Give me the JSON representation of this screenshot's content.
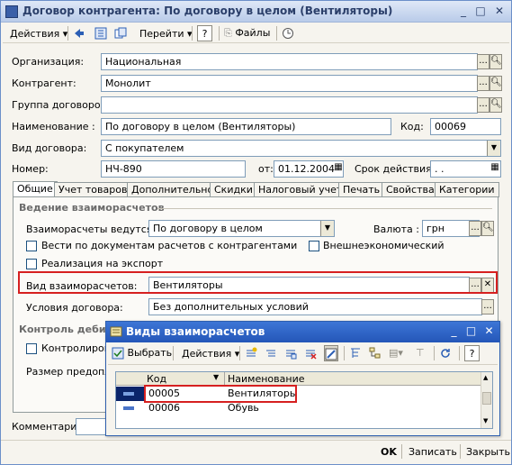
{
  "window": {
    "title": "Договор контрагента: По договору в целом (Вентиляторы)",
    "controls": {
      "minimize": "_",
      "maximize": "□",
      "close": "✕"
    }
  },
  "toolbar": {
    "actions_label": "Действия",
    "goto_label": "Перейти",
    "help_label": "?",
    "files_label": "Файлы"
  },
  "form": {
    "org_label": "Организация:",
    "org_value": "Национальная",
    "counterparty_label": "Контрагент:",
    "counterparty_value": "Монолит",
    "group_label": "Группа договоров:",
    "group_value": "",
    "name_label": "Наименование :",
    "name_value": "По договору в целом (Вентиляторы)",
    "code_label": "Код:",
    "code_value": "00069",
    "type_label": "Вид договора:",
    "type_value": "С покупателем",
    "number_label": "Номер:",
    "number_value": "НЧ-890",
    "from_label": "от:",
    "from_value": "01.12.2004",
    "validity_label": "Срок действия:",
    "validity_value": " .  ."
  },
  "tabs": [
    "Общие",
    "Учет товаров",
    "Дополнительно",
    "Скидки",
    "Налоговый учет",
    "Печать",
    "Свойства",
    "Категории"
  ],
  "general": {
    "section_title": "Ведение взаиморасчетов",
    "settlement_label": "Взаиморасчеты ведутся:",
    "settlement_value": "По договору в целом",
    "currency_label": "Валюта :",
    "currency_value": "грн",
    "doc_settlement_check": "Вести по документам расчетов с контрагентами",
    "foreign_trade_check": "Внешнеэкономический",
    "export_check": "Реализация на экспорт",
    "kind_label": "Вид взаиморасчетов:",
    "kind_value": "Вентиляторы",
    "conditions_label": "Условия договора:",
    "conditions_value": "Без дополнительных условий",
    "control_section": "Контроль дебит",
    "control_check": "Контролирова",
    "limit_label": "Размер предопла"
  },
  "comment_label": "Комментарий:",
  "bottom": {
    "ok": "OK",
    "save": "Записать",
    "close": "Закрыть"
  },
  "subwindow": {
    "title": "Виды взаиморасчетов",
    "select_label": "Выбрать",
    "actions_label": "Действия",
    "help_label": "?",
    "columns": [
      "Код",
      "Наименование"
    ],
    "rows": [
      {
        "code": "00005",
        "name": "Вентиляторы"
      },
      {
        "code": "00006",
        "name": "Обувь"
      }
    ]
  },
  "colors": {
    "highlight": "#d62020",
    "title_active": "#2456b8",
    "selected_row": "#0a246a"
  }
}
